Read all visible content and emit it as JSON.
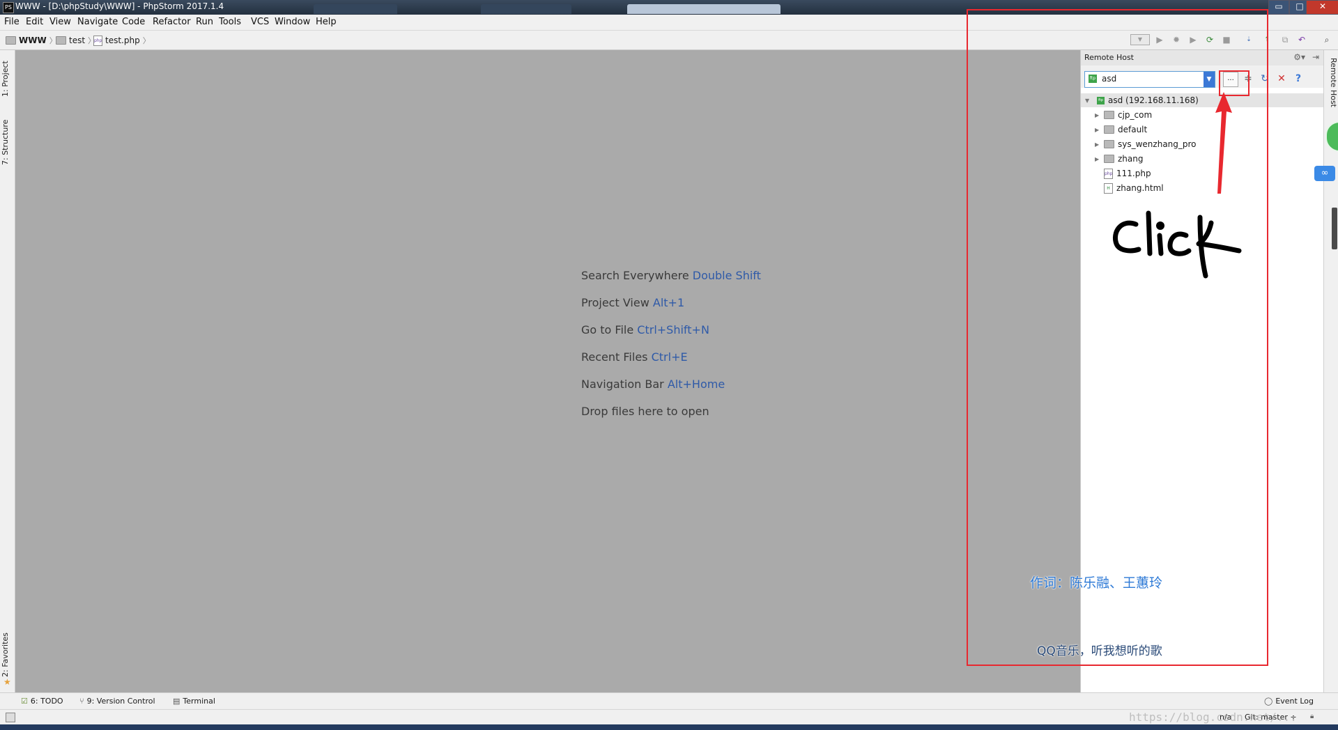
{
  "window": {
    "title": "WWW - [D:\\phpStudy\\WWW] - PhpStorm 2017.1.4",
    "app_icon": "PS",
    "minimize": "▭",
    "maximize": "□",
    "close": "✕"
  },
  "menu": [
    "File",
    "Edit",
    "View",
    "Navigate",
    "Code",
    "Refactor",
    "Run",
    "Tools",
    "VCS",
    "Window",
    "Help"
  ],
  "breadcrumb": {
    "root": "WWW",
    "folder": "test",
    "file": "test.php",
    "separator": "〉"
  },
  "left_tabs": {
    "project": "1: Project",
    "structure": "7: Structure",
    "favorites": "2: Favorites"
  },
  "editor_hints": [
    {
      "label": "Search Everywhere",
      "key": "Double Shift"
    },
    {
      "label": "Project View",
      "key": "Alt+1"
    },
    {
      "label": "Go to File",
      "key": "Ctrl+Shift+N"
    },
    {
      "label": "Recent Files",
      "key": "Ctrl+E"
    },
    {
      "label": "Navigation Bar",
      "key": "Alt+Home"
    },
    {
      "label": "Drop files here to open",
      "key": ""
    }
  ],
  "remote_host": {
    "title": "Remote Host",
    "server_select": "asd",
    "browse_label": "...",
    "root": "asd (192.168.11.168)",
    "items": [
      {
        "name": "cjp_com",
        "kind": "folder"
      },
      {
        "name": "default",
        "kind": "folder"
      },
      {
        "name": "sys_wenzhang_pro",
        "kind": "folder"
      },
      {
        "name": "zhang",
        "kind": "folder"
      },
      {
        "name": "111.php",
        "kind": "php"
      },
      {
        "name": "zhang.html",
        "kind": "html"
      }
    ]
  },
  "right_tab": "Remote Host",
  "bottom_tabs": {
    "todo": "6: TODO",
    "vcs": "9: Version Control",
    "terminal": "Terminal",
    "event_log": "Event Log"
  },
  "status": {
    "position": "n/a",
    "git": "Git: master ÷"
  },
  "annotation": {
    "click_text": "click",
    "lyric_1": "作词：陈乐融、王蕙玲",
    "lyric_2": "QQ音乐，听我想听的歌",
    "watermark": "https://blog.csdn.net/...",
    "box_color": "#e8282f"
  },
  "colors": {
    "accent": "#2f5aa8",
    "select_arrow": "#3b78d6",
    "ftp_green": "#3ea34a"
  }
}
